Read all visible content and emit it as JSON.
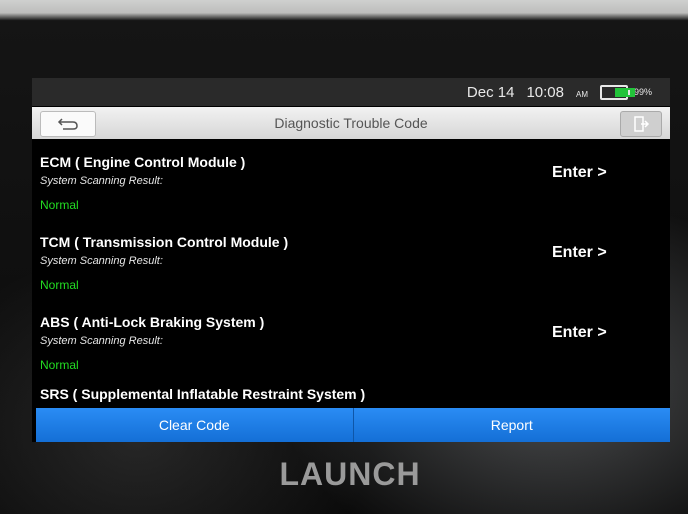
{
  "status_bar": {
    "date": "Dec 14",
    "time": "10:08",
    "ampm": "AM",
    "battery_label": "99%",
    "battery_level": 0.99
  },
  "header": {
    "title": "Diagnostic Trouble Code"
  },
  "modules": [
    {
      "title": "ECM ( Engine Control Module )",
      "subtitle": "System Scanning Result:",
      "status": "Normal",
      "action": "Enter >"
    },
    {
      "title": "TCM ( Transmission Control Module )",
      "subtitle": "System Scanning Result:",
      "status": "Normal",
      "action": "Enter >"
    },
    {
      "title": "ABS ( Anti-Lock Braking System )",
      "subtitle": "System Scanning Result:",
      "status": "Normal",
      "action": "Enter >"
    }
  ],
  "partial_module": {
    "title": "SRS ( Supplemental Inflatable Restraint System )"
  },
  "footer": {
    "clear_label": "Clear Code",
    "report_label": "Report"
  },
  "brand": "LAUNCH",
  "colors": {
    "status_normal": "#22dd22",
    "footer_blue": "#1a7be6",
    "battery_green": "#22c43a"
  }
}
